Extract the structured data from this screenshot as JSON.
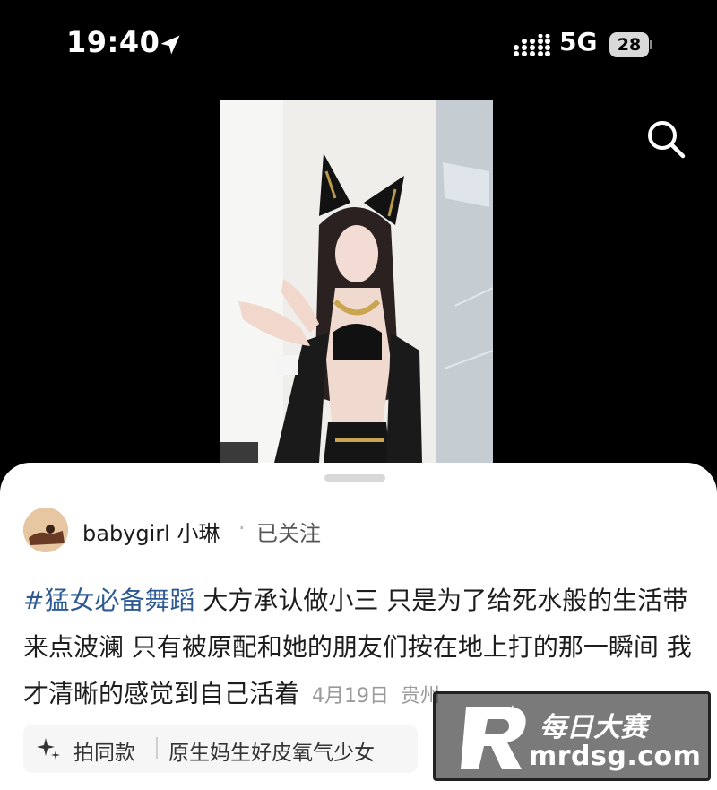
{
  "status_bar": {
    "time": "19:40",
    "network": "5G",
    "battery": "28"
  },
  "video": {
    "icon": "video-thumbnail"
  },
  "search": {
    "icon": "search-icon"
  },
  "post": {
    "author": "babygirl 小琳",
    "separator": "·",
    "follow_status": "已关注",
    "hashtag": "#猛女必备舞蹈",
    "body": " 大方承认做小三 只是为了给死水般的生活带来点波澜 只有被原配和她的朋友们按在地上打的那一瞬间 我才清晰的感觉到自己活着",
    "date": "4月19日",
    "location": "贵州"
  },
  "bottom_bar": {
    "same_style_label": "拍同款",
    "music_title": "原生妈生好皮氧气少女"
  },
  "watermark": {
    "brand_top": "每日大赛",
    "brand_bottom": "mrdsg.com"
  },
  "colors": {
    "hashtag": "#2e5a94",
    "sheet_bg": "#ffffff",
    "screen_bg": "#000000"
  }
}
